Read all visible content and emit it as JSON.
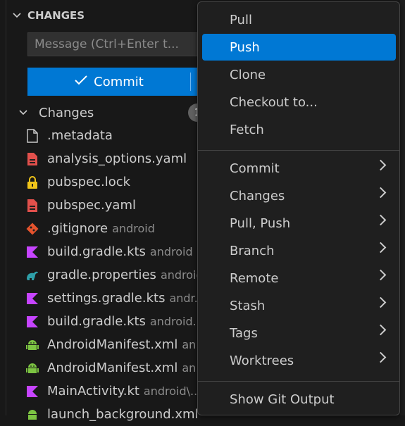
{
  "scm": {
    "section_title": "CHANGES",
    "message_placeholder": "Message (Ctrl+Enter t...",
    "commit_label": "Commit",
    "changes_label": "Changes",
    "changes_count": "1",
    "files": [
      {
        "name": ".metadata",
        "desc": "",
        "icon": "file-icon"
      },
      {
        "name": "analysis_options.yaml",
        "desc": "",
        "icon": "yaml-file-icon"
      },
      {
        "name": "pubspec.lock",
        "desc": "",
        "icon": "lock-file-icon"
      },
      {
        "name": "pubspec.yaml",
        "desc": "",
        "icon": "yaml-file-icon"
      },
      {
        "name": ".gitignore",
        "desc": "android",
        "icon": "git-file-icon"
      },
      {
        "name": "build.gradle.kts",
        "desc": "android",
        "icon": "kotlin-file-icon"
      },
      {
        "name": "gradle.properties",
        "desc": "android",
        "icon": "gradle-file-icon"
      },
      {
        "name": "settings.gradle.kts",
        "desc": "andr...",
        "icon": "kotlin-file-icon"
      },
      {
        "name": "build.gradle.kts",
        "desc": "android...",
        "icon": "kotlin-file-icon"
      },
      {
        "name": "AndroidManifest.xml",
        "desc": "an...",
        "icon": "android-file-icon"
      },
      {
        "name": "AndroidManifest.xml",
        "desc": "an...",
        "icon": "android-file-icon"
      },
      {
        "name": "MainActivity.kt",
        "desc": "android\\...",
        "icon": "kotlin-file-icon"
      },
      {
        "name": "launch_background.xml",
        "desc": "",
        "icon": "android-file-icon"
      }
    ]
  },
  "menu": {
    "group1": [
      "Pull",
      "Push",
      "Clone",
      "Checkout to...",
      "Fetch"
    ],
    "group2": [
      "Commit",
      "Changes",
      "Pull, Push",
      "Branch",
      "Remote",
      "Stash",
      "Tags",
      "Worktrees"
    ],
    "group3": [
      "Show Git Output"
    ],
    "active_item": "Push"
  },
  "colors": {
    "accent": "#0078d4",
    "background": "#181818",
    "menu_background": "#1f1f1f"
  }
}
